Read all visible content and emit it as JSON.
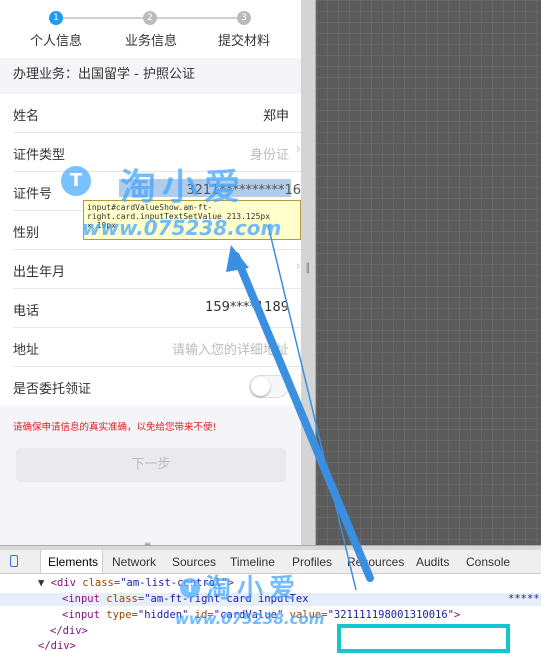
{
  "steps": [
    {
      "num": "1",
      "label": "个人信息"
    },
    {
      "num": "2",
      "label": "业务信息"
    },
    {
      "num": "3",
      "label": "提交材料"
    }
  ],
  "business_line": "办理业务：出国留学 - 护照公证",
  "form": {
    "name": {
      "label": "姓名",
      "value": "郑申"
    },
    "id_type": {
      "label": "证件类型",
      "value": "身份证"
    },
    "id_number": {
      "label": "证件号",
      "value": "3211**********16"
    },
    "gender": {
      "label": "性别"
    },
    "birth": {
      "label": "出生年月"
    },
    "phone": {
      "label": "电话",
      "value": "159****1189"
    },
    "address": {
      "label": "地址",
      "placeholder": "请输入您的详细地址"
    },
    "delegate": {
      "label": "是否委托领证",
      "on": false
    }
  },
  "warning": "请确保申请信息的真实准确，以免给您带来不便!",
  "next_button": "下一步",
  "tooltip": {
    "line1": "input#cardValueShow.am-ft-",
    "line2": "right.card.inputTextSetValue 213.125px",
    "line3": "× 19px"
  },
  "devtools": {
    "tabs": [
      "Elements",
      "Network",
      "Sources",
      "Timeline",
      "Profiles",
      "Resources",
      "Audits",
      "Console"
    ],
    "selected_tab": "Elements",
    "code": {
      "line1_tag": "<div ",
      "line1_attr": "class=",
      "line1_val": "\"am-list-control\"",
      "line1_end": ">",
      "line2_tag": "<input ",
      "line2_attr": "class=",
      "line2_val": "\"am-ft-right card inputTex",
      "line2_tail": "*****",
      "line3_tag": "<input ",
      "line3_attr1": "type=",
      "line3_val1": "\"hidden\"",
      "line3_attr2": " id=",
      "line3_val2": "\"cardValue\"",
      "line3_attr3": " value=",
      "line3_val3": "\"321111198001310016\"",
      "line3_end": ">",
      "line4": "</div>",
      "line5": "</div>"
    }
  },
  "watermark": {
    "brand": "淘小爱",
    "url": "www.075238.com",
    "logo_letter": "T"
  },
  "colors": {
    "accent": "#1e9cf0",
    "warning": "#e02020",
    "highlight_box": "#19c5cc",
    "arrow": "#3b8fe0"
  }
}
